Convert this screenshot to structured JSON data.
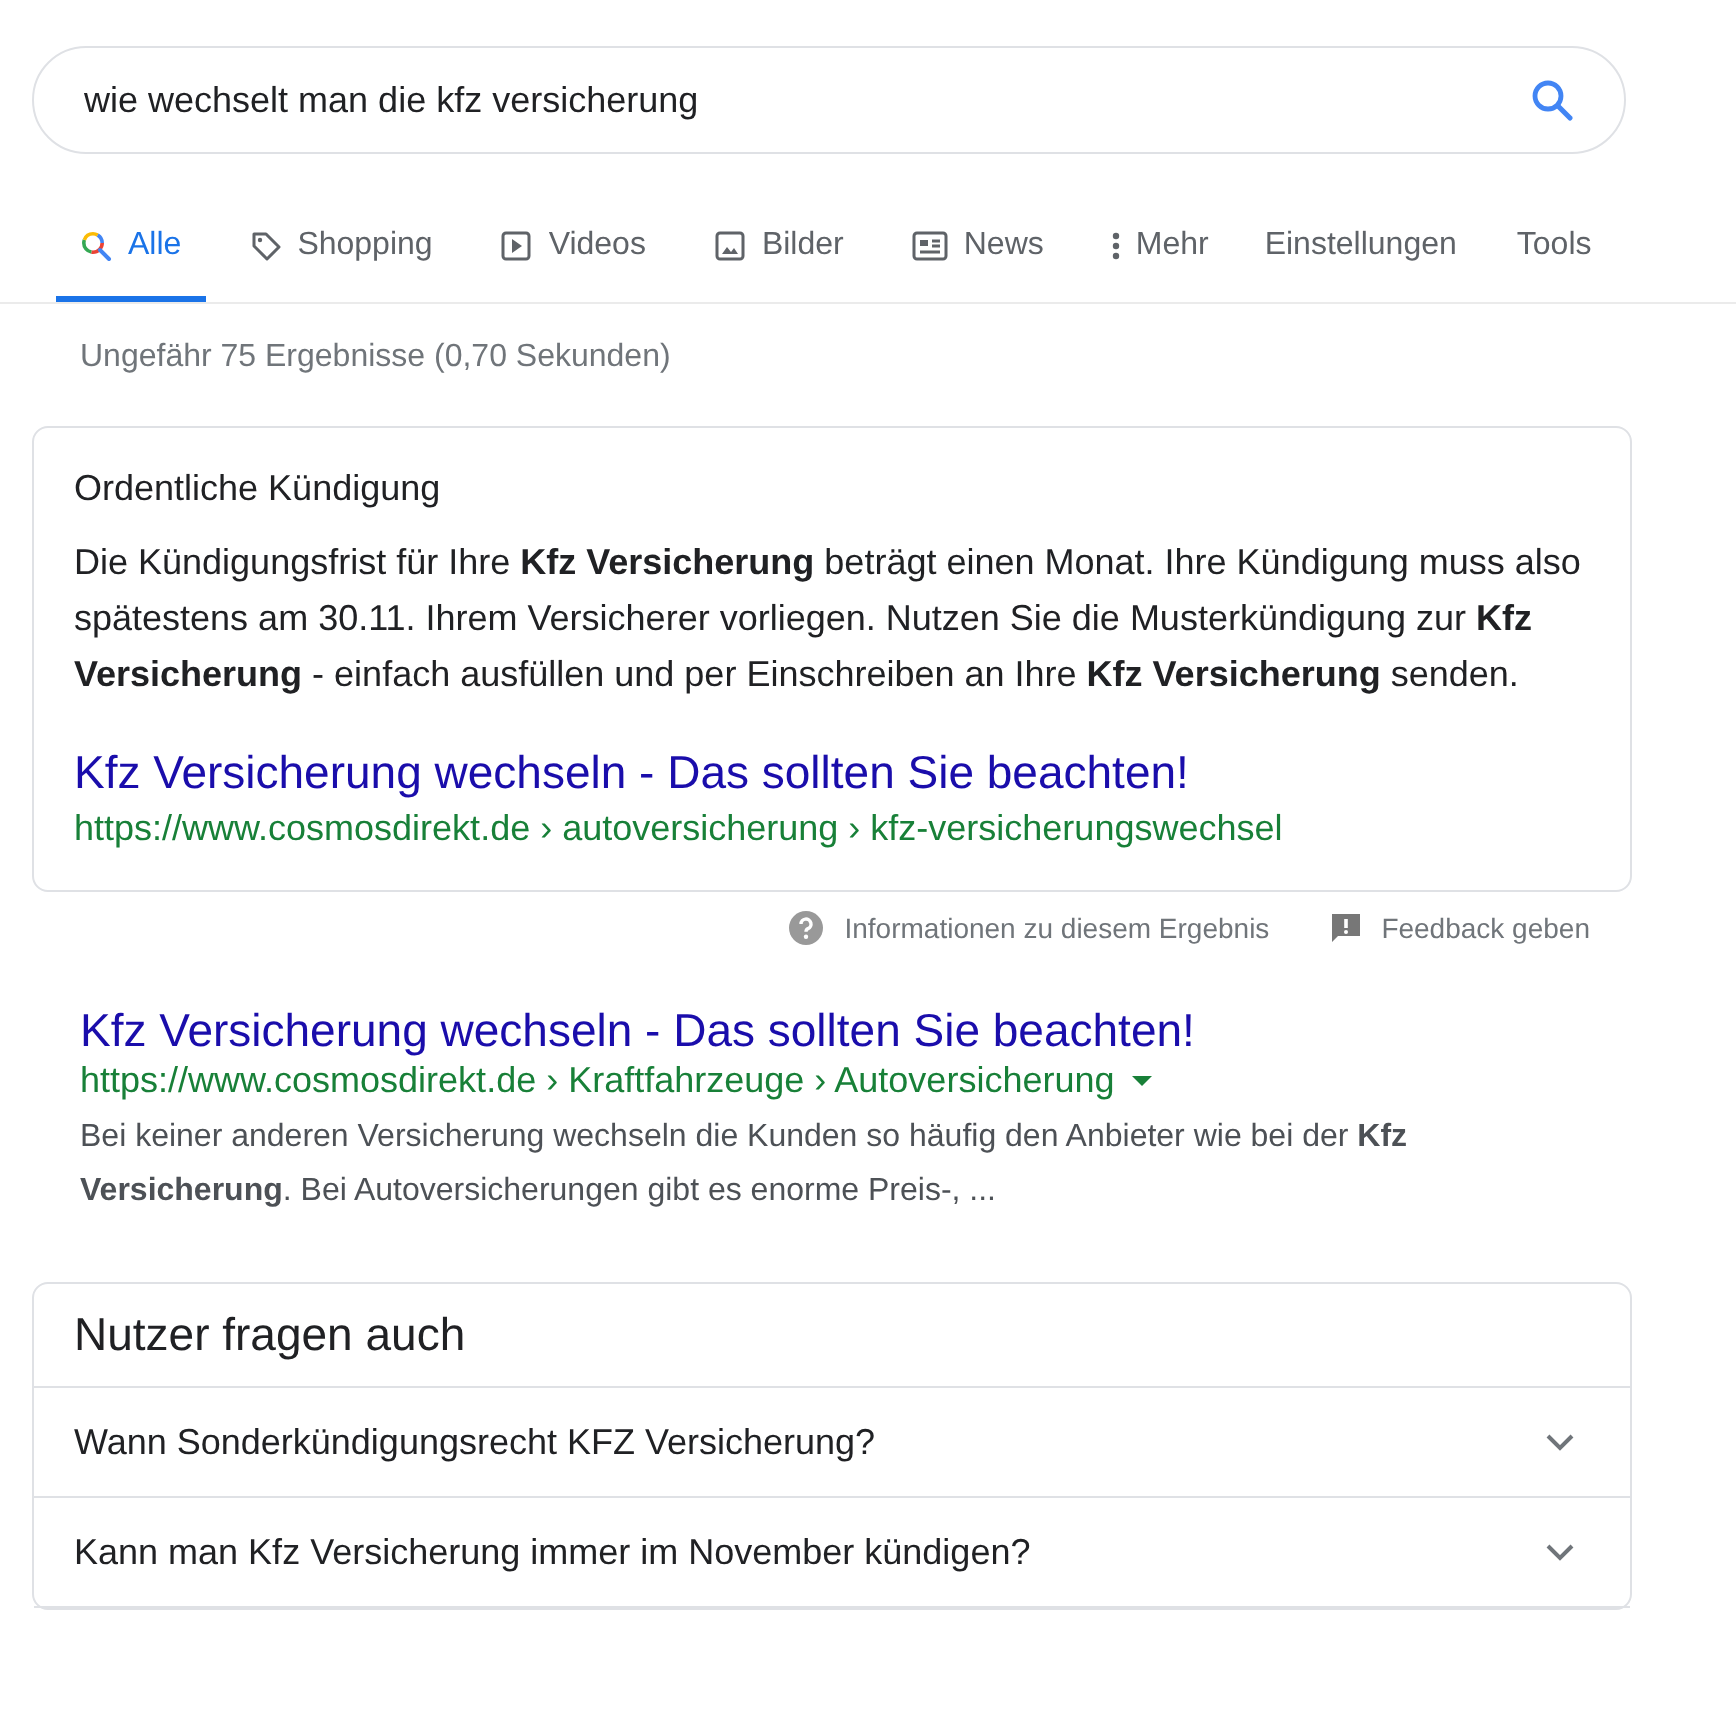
{
  "search": {
    "value": "wie wechselt man die kfz versicherung"
  },
  "tabs": [
    {
      "label": "Alle",
      "kind": "search",
      "selected": true
    },
    {
      "label": "Shopping",
      "kind": "tag",
      "selected": false
    },
    {
      "label": "Videos",
      "kind": "play",
      "selected": false
    },
    {
      "label": "Bilder",
      "kind": "image",
      "selected": false
    },
    {
      "label": "News",
      "kind": "news",
      "selected": false
    },
    {
      "label": "Mehr",
      "kind": "more",
      "selected": false
    }
  ],
  "tool_links": [
    "Einstellungen",
    "Tools"
  ],
  "result_stats": "Ungefähr 75 Ergebnisse (0,70 Sekunden)",
  "featured_snippet": {
    "heading": "Ordentliche Kündigung",
    "text": "Die Kündigungsfrist für Ihre **Kfz Versicherung** beträgt einen Monat. Ihre Kündigung muss also spätestens am 30.11. Ihrem Versicherer vorliegen. Nutzen Sie die Musterkündigung zur **Kfz Versicherung** - einfach ausfüllen und per Einschreiben an Ihre **Kfz Versicherung** senden.",
    "title": "Kfz Versicherung wechseln - Das sollten Sie beachten!",
    "url": "https://www.cosmosdirekt.de › autoversicherung › kfz-versicherungswechsel"
  },
  "snippet_footer": {
    "info": "Informationen zu diesem Ergebnis",
    "feedback": "Feedback geben"
  },
  "results": [
    {
      "title": "Kfz Versicherung wechseln - Das sollten Sie beachten!",
      "url": "https://www.cosmosdirekt.de › Kraftfahrzeuge › Autoversicherung",
      "description": "Bei keiner anderen Versicherung wechseln die Kunden so häufig den Anbieter wie bei der **Kfz Versicherung**. Bei Autoversicherungen gibt es enorme Preis-, ..."
    }
  ],
  "people_also_ask": {
    "heading": "Nutzer fragen auch",
    "questions": [
      {
        "text": "Wann Sonderkündigungsrecht KFZ Versicherung?",
        "expanded": false
      },
      {
        "text": "Kann man Kfz Versicherung immer im November kündigen?",
        "expanded": false
      }
    ]
  }
}
